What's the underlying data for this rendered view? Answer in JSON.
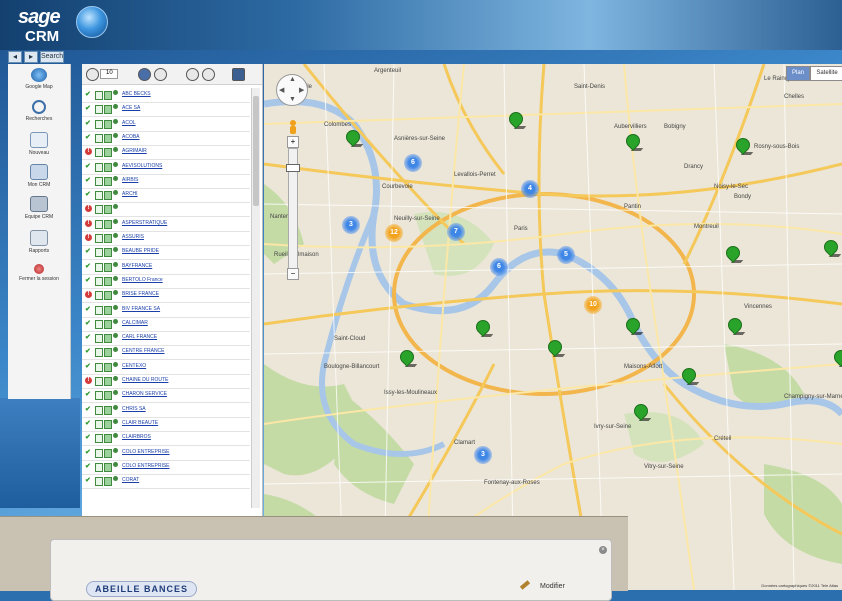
{
  "app": {
    "logo_top": "sage",
    "logo_bottom": "CRM"
  },
  "nav": {
    "back": "◂",
    "fwd": "▸",
    "search": "Search"
  },
  "sidebar": {
    "items": [
      {
        "label": "Google Map",
        "icon": "globe-icon"
      },
      {
        "label": "Recherches",
        "icon": "magnifier-icon"
      },
      {
        "label": "Nouveau",
        "icon": "document-icon"
      },
      {
        "label": "Mon CRM",
        "icon": "satellite-icon"
      },
      {
        "label": "Equipe CRM",
        "icon": "team-icon"
      },
      {
        "label": "Rapports",
        "icon": "report-icon"
      },
      {
        "label": "Fermer la session",
        "icon": "logout-icon"
      }
    ]
  },
  "list": {
    "toolbar_value": "10",
    "rows": [
      {
        "label": "ABC BECKS",
        "status": "ok"
      },
      {
        "label": "ACE SA",
        "status": "ok"
      },
      {
        "label": "ACOL",
        "status": "ok"
      },
      {
        "label": "ACOBA",
        "status": "ok"
      },
      {
        "label": "AGRIMAIR",
        "status": "warn"
      },
      {
        "label": "AEVISOLUTIONS",
        "status": "ok"
      },
      {
        "label": "AIRBIS",
        "status": "ok"
      },
      {
        "label": "ARCHI",
        "status": "ok"
      },
      {
        "label": "",
        "status": "warn"
      },
      {
        "label": "ASPERSTRATIQUE",
        "status": "warn"
      },
      {
        "label": "ASSURIS",
        "status": "warn"
      },
      {
        "label": "BEAUBE PRIDE",
        "status": "ok"
      },
      {
        "label": "BAYFRANCE",
        "status": "ok"
      },
      {
        "label": "BERTOLO France",
        "status": "ok"
      },
      {
        "label": "BRISE FRANCE",
        "status": "warn"
      },
      {
        "label": "BIV FRANCE SA",
        "status": "ok"
      },
      {
        "label": "CALCIMAR",
        "status": "ok"
      },
      {
        "label": "CARL FRANCE",
        "status": "ok"
      },
      {
        "label": "CENTRE FRANCE",
        "status": "ok"
      },
      {
        "label": "CENTEXO",
        "status": "ok"
      },
      {
        "label": "CHAINE DU ROUTE",
        "status": "warn"
      },
      {
        "label": "CHARON SERVICE",
        "status": "ok"
      },
      {
        "label": "CHRIS SA",
        "status": "ok"
      },
      {
        "label": "CLAIR BEAUTE",
        "status": "ok"
      },
      {
        "label": "CLAIRBROS",
        "status": "ok"
      },
      {
        "label": "COLO ENTREPRISE",
        "status": "ok"
      },
      {
        "label": "COLO ENTREPRISE",
        "status": "ok"
      },
      {
        "label": "CORAT",
        "status": "ok"
      }
    ]
  },
  "map": {
    "map_type_map": "Plan",
    "map_type_sat": "Satellite",
    "labels": [
      "Argenteuil",
      "Sartrouville",
      "Colombes",
      "Asnières-sur-Seine",
      "Saint-Denis",
      "Aubervilliers",
      "Courbevoie",
      "Levallois-Perret",
      "Nanterre",
      "Rueil-Malmaison",
      "Neuilly-sur-Seine",
      "Paris",
      "Pantin",
      "Montreuil",
      "Vincennes",
      "Saint-Cloud",
      "Boulogne-Billancourt",
      "Issy-les-Moulineaux",
      "Ivry-sur-Seine",
      "Créteil",
      "Clamart",
      "Vitry-sur-Seine",
      "Fontenay-aux-Roses",
      "Drancy",
      "Bobigny",
      "Rosny-sous-Bois",
      "Noisy-le-Sec",
      "Chelles",
      "Champigny-sur-Marne",
      "Maisons-Alfort",
      "Le Raincy",
      "Bondy"
    ],
    "clusters": [
      {
        "count": "6",
        "color": "blue"
      },
      {
        "count": "3",
        "color": "blue"
      },
      {
        "count": "4",
        "color": "blue"
      },
      {
        "count": "7",
        "color": "blue"
      },
      {
        "count": "6",
        "color": "blue"
      },
      {
        "count": "5",
        "color": "blue"
      },
      {
        "count": "3",
        "color": "blue"
      },
      {
        "count": "12",
        "color": "orange"
      },
      {
        "count": "10",
        "color": "orange"
      }
    ],
    "copyright": "Données cartographiques ©2011 Tele Atlas"
  },
  "popup": {
    "title": "ABEILLE BANCES",
    "modify": "Modifier",
    "close": "×"
  },
  "colors": {
    "accent_blue": "#2d6aa3",
    "pin_green": "#29a329",
    "cluster_blue": "#3f87e6",
    "cluster_orange": "#f3a21b"
  }
}
